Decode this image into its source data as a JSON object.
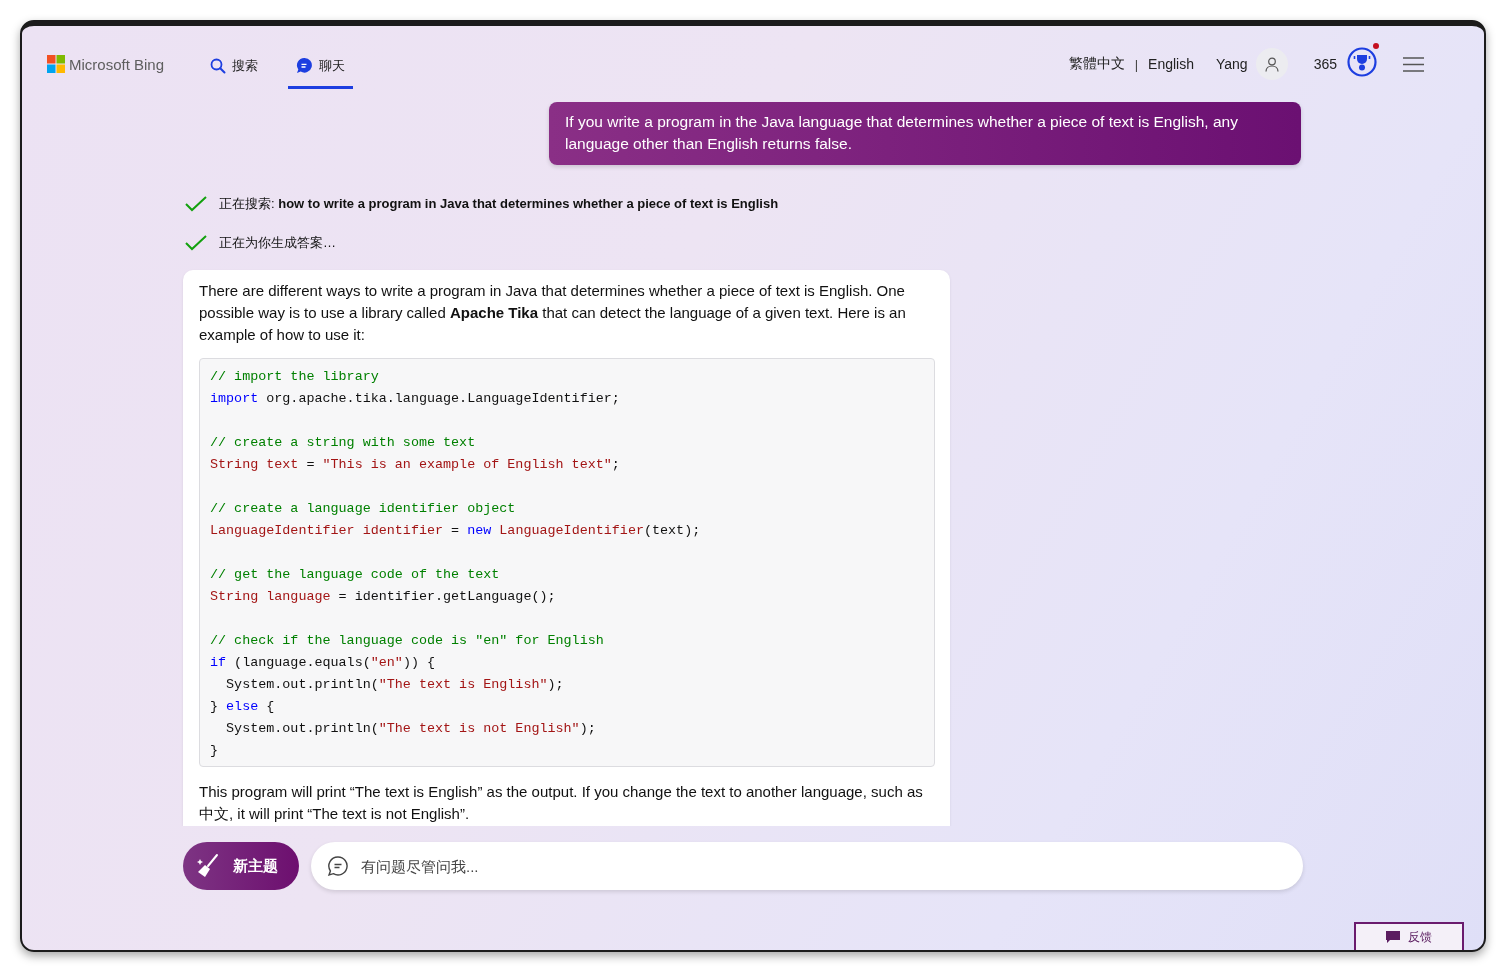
{
  "header": {
    "brand": "Microsoft Bing",
    "tabs": [
      {
        "label": "搜索",
        "kind": "search",
        "selected": false
      },
      {
        "label": "聊天",
        "kind": "chat",
        "selected": true
      }
    ],
    "languages": [
      "繁體中文",
      "English"
    ],
    "separator": "|",
    "user": "Yang",
    "points": "365",
    "notification": true
  },
  "user_message": "If you write a program in the Java language that determines whether a piece of text is English, any language other than English returns false.",
  "steps": [
    {
      "text": "正在搜索: **how to write a program in Java that determines whether a piece of text is English**",
      "done": true
    },
    {
      "text": "正在为你生成答案…",
      "done": true
    }
  ],
  "answer": {
    "intro": "There are different ways to write a program in Java that determines whether a piece of text is English. One possible way is to use a library called **Apache Tika** that can detect the language of a given text. Here is an example of how to use it:",
    "code": [
      {
        "kind": "code",
        "tokens": [
          {
            "kind": "comment",
            "text": "// import the library"
          }
        ]
      },
      {
        "kind": "code",
        "tokens": [
          {
            "kind": "keyword",
            "text": "import"
          },
          {
            "kind": "plain",
            "text": " org.apache.tika.language.LanguageIdentifier;"
          }
        ]
      },
      {
        "kind": "blank"
      },
      {
        "kind": "code",
        "tokens": [
          {
            "kind": "comment",
            "text": "// create a string with some text"
          }
        ]
      },
      {
        "kind": "code",
        "tokens": [
          {
            "kind": "type",
            "text": "String text"
          },
          {
            "kind": "plain",
            "text": " = "
          },
          {
            "kind": "string",
            "text": "\"This is an example of English text\""
          },
          {
            "kind": "plain",
            "text": ";"
          }
        ]
      },
      {
        "kind": "blank"
      },
      {
        "kind": "code",
        "tokens": [
          {
            "kind": "comment",
            "text": "// create a language identifier object"
          }
        ]
      },
      {
        "kind": "code",
        "tokens": [
          {
            "kind": "type",
            "text": "LanguageIdentifier identifier"
          },
          {
            "kind": "plain",
            "text": " = "
          },
          {
            "kind": "keyword",
            "text": "new "
          },
          {
            "kind": "type",
            "text": "LanguageIdentifier"
          },
          {
            "kind": "plain",
            "text": "(text);"
          }
        ]
      },
      {
        "kind": "blank"
      },
      {
        "kind": "code",
        "tokens": [
          {
            "kind": "comment",
            "text": "// get the language code of the text"
          }
        ]
      },
      {
        "kind": "code",
        "tokens": [
          {
            "kind": "type",
            "text": "String language"
          },
          {
            "kind": "plain",
            "text": " = identifier.getLanguage();"
          }
        ]
      },
      {
        "kind": "blank"
      },
      {
        "kind": "code",
        "tokens": [
          {
            "kind": "comment",
            "text": "// check if the language code is \"en\" for English"
          }
        ]
      },
      {
        "kind": "code",
        "tokens": [
          {
            "kind": "keyword",
            "text": "if"
          },
          {
            "kind": "plain",
            "text": " (language.equals("
          },
          {
            "kind": "string",
            "text": "\"en\""
          },
          {
            "kind": "plain",
            "text": ")) {"
          }
        ]
      },
      {
        "kind": "code",
        "tokens": [
          {
            "kind": "plain",
            "text": "  System.out.println("
          },
          {
            "kind": "string",
            "text": "\"The text is English\""
          },
          {
            "kind": "plain",
            "text": ");"
          }
        ]
      },
      {
        "kind": "code",
        "tokens": [
          {
            "kind": "plain",
            "text": "} "
          },
          {
            "kind": "keyword",
            "text": "else"
          },
          {
            "kind": "plain",
            "text": " {"
          }
        ]
      },
      {
        "kind": "code",
        "tokens": [
          {
            "kind": "plain",
            "text": "  System.out.println("
          },
          {
            "kind": "string",
            "text": "\"The text is not English\""
          },
          {
            "kind": "plain",
            "text": ");"
          }
        ]
      },
      {
        "kind": "code",
        "tokens": [
          {
            "kind": "plain",
            "text": "}"
          }
        ]
      }
    ],
    "outro": "This program will print “The text is English” as the output. If you change the text to another language, such as 中文, it will print “The text is not English”."
  },
  "composer": {
    "new_topic": "新主题",
    "placeholder": "有问题尽管问我..."
  },
  "feedback": "反馈"
}
